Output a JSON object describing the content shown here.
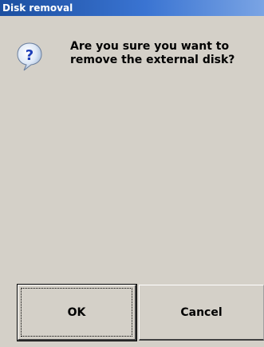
{
  "window": {
    "title": "Disk removal"
  },
  "dialog": {
    "icon": "question-icon",
    "message_lines": [
      "Are you sure you want to",
      "remove the external disk?"
    ]
  },
  "buttons": {
    "ok_label": "OK",
    "cancel_label": "Cancel"
  },
  "colors": {
    "titlebar_start": "#1c4fa0",
    "titlebar_end": "#7aa4e4",
    "face": "#d4d0c8"
  }
}
